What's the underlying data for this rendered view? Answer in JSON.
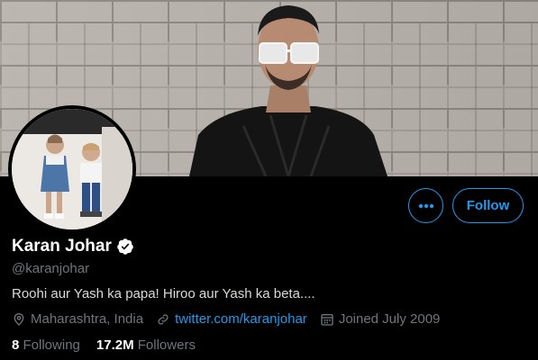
{
  "profile": {
    "name": "Karan Johar",
    "handle": "@karanjohar",
    "bio": "Roohi aur Yash ka papa! Hiroo aur Yash ka beta....",
    "location": "Maharashtra, India",
    "website": "twitter.com/karanjohar",
    "joined": "Joined July 2009",
    "verified_icon": "verified-badge-icon"
  },
  "actions": {
    "more_icon": "more-options-icon",
    "follow_label": "Follow"
  },
  "stats": {
    "following_count": "8",
    "following_label": "Following",
    "followers_count": "17.2M",
    "followers_label": "Followers"
  },
  "colors": {
    "accent": "#1d9bf0",
    "background": "#000000",
    "secondary_text": "#6e767d"
  }
}
